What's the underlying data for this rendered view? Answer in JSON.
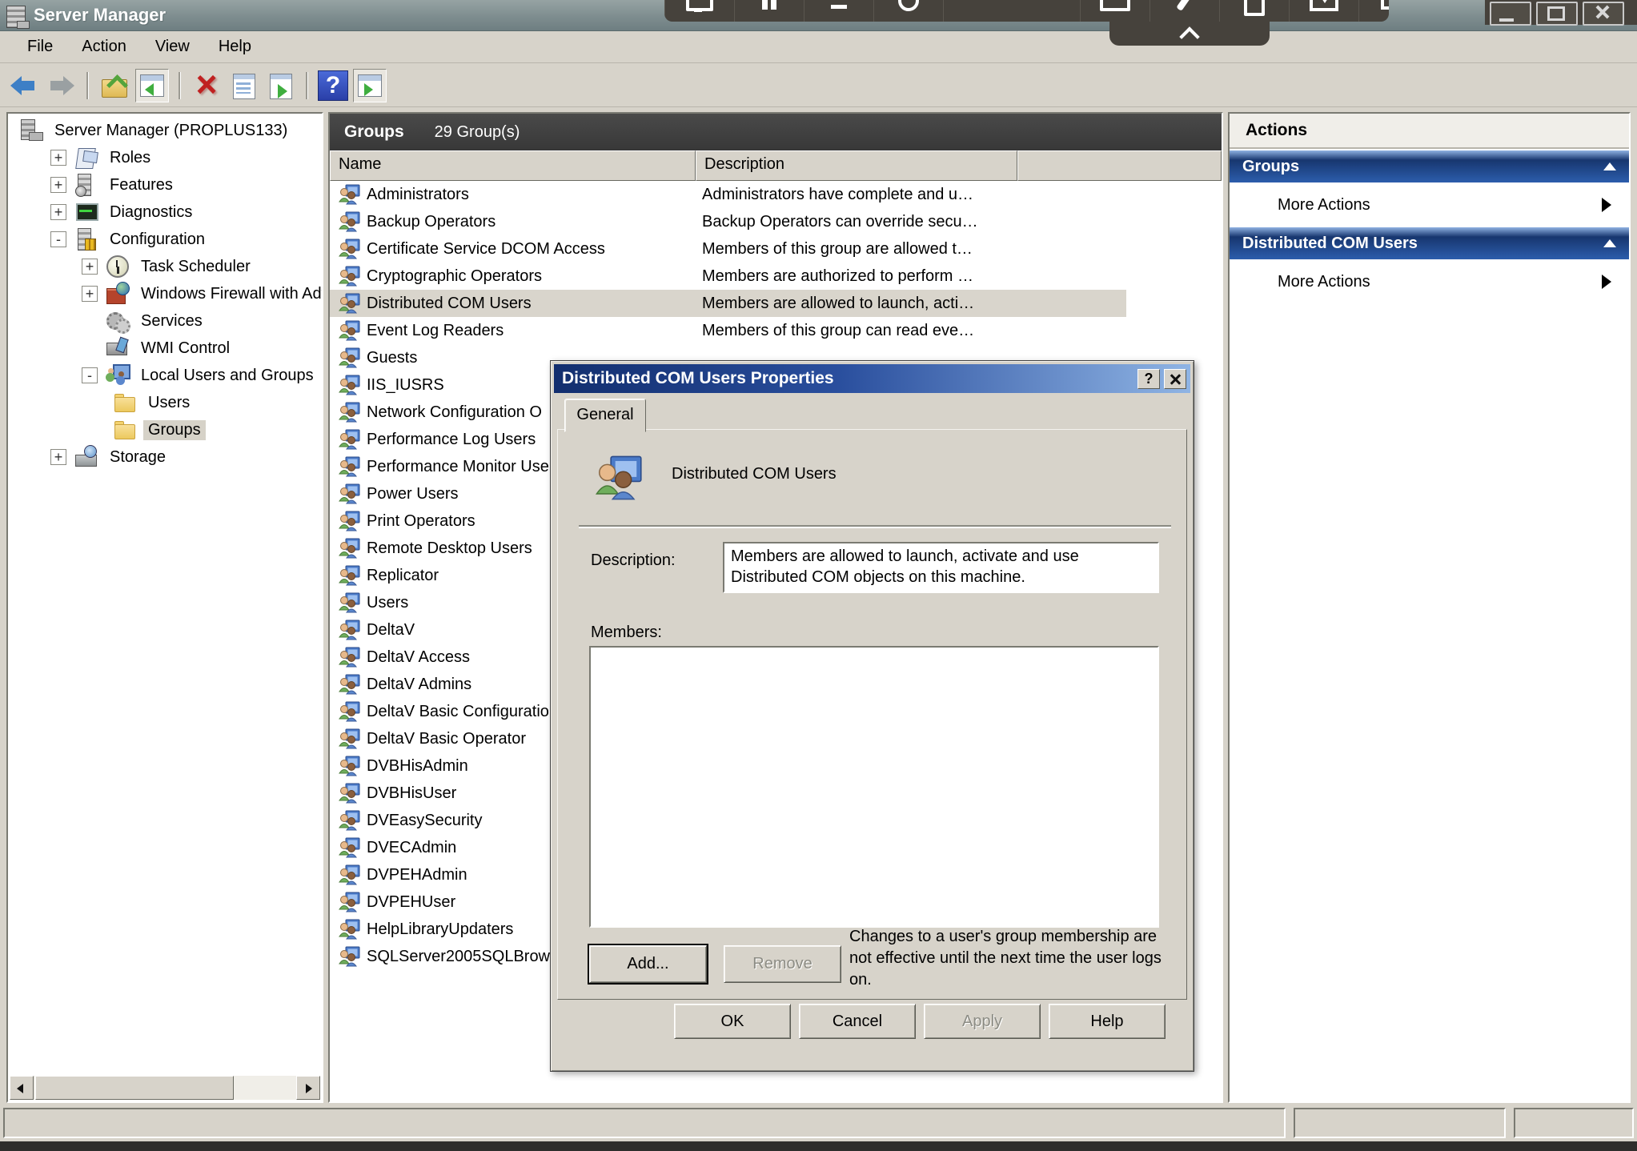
{
  "window": {
    "title": "Server Manager",
    "controls": [
      {
        "name": "minimize-button"
      },
      {
        "name": "maximize-button"
      },
      {
        "name": "close-button"
      }
    ]
  },
  "overlay_toolbar": {
    "icons": [
      {
        "name": "display"
      },
      {
        "name": "pause"
      },
      {
        "name": "minimize"
      },
      {
        "name": "record"
      },
      {
        "name": "spacer"
      },
      {
        "name": "window"
      },
      {
        "name": "tools"
      },
      {
        "name": "clipboard"
      },
      {
        "name": "present"
      },
      {
        "name": "dual-display"
      },
      {
        "name": "grid"
      }
    ]
  },
  "menu": {
    "items": [
      {
        "label": "File"
      },
      {
        "label": "Action"
      },
      {
        "label": "View"
      },
      {
        "label": "Help"
      }
    ]
  },
  "toolbar": {
    "buttons": [
      {
        "name": "back-button"
      },
      {
        "name": "forward-button"
      },
      {
        "name": "toolbar-separator"
      },
      {
        "name": "up-level-button"
      },
      {
        "name": "console-tree-button",
        "active": true
      },
      {
        "name": "toolbar-separator"
      },
      {
        "name": "delete-button",
        "glyph": "×"
      },
      {
        "name": "properties-button"
      },
      {
        "name": "export-list-button"
      },
      {
        "name": "toolbar-separator"
      },
      {
        "name": "help-button",
        "glyph": "?"
      },
      {
        "name": "action-pane-button",
        "active": true
      }
    ]
  },
  "tree": {
    "items": [
      {
        "label": "Server Manager (PROPLUS133)",
        "level": 0,
        "expander": "",
        "noslot": true,
        "icon": "server-manager"
      },
      {
        "label": "Roles",
        "level": 1,
        "expander": "+",
        "icon": "roles"
      },
      {
        "label": "Features",
        "level": 1,
        "expander": "+",
        "icon": "features"
      },
      {
        "label": "Diagnostics",
        "level": 1,
        "expander": "+",
        "icon": "diagnostics"
      },
      {
        "label": "Configuration",
        "level": 1,
        "expander": "-",
        "icon": "configuration"
      },
      {
        "label": "Task Scheduler",
        "level": 2,
        "expander": "+",
        "icon": "task-scheduler"
      },
      {
        "label": "Windows Firewall with Adva",
        "level": 2,
        "expander": "+",
        "icon": "firewall"
      },
      {
        "label": "Services",
        "level": 2,
        "expander": "",
        "icon": "services"
      },
      {
        "label": "WMI Control",
        "level": 2,
        "expander": "",
        "icon": "wmi"
      },
      {
        "label": "Local Users and Groups",
        "level": 2,
        "expander": "-",
        "icon": "local-users"
      },
      {
        "label": "Users",
        "level": 3,
        "expander": "",
        "noslot": true,
        "icon": "folder"
      },
      {
        "label": "Groups",
        "level": 3,
        "expander": "",
        "noslot": true,
        "icon": "folder",
        "selected": true
      },
      {
        "label": "Storage",
        "level": 1,
        "expander": "+",
        "icon": "storage"
      }
    ]
  },
  "groups_pane": {
    "title": "Groups",
    "count_label": "29 Group(s)",
    "columns": {
      "name": "Name",
      "description": "Description"
    },
    "rows": [
      {
        "name": "Administrators",
        "description": "Administrators have complete and u…"
      },
      {
        "name": "Backup Operators",
        "description": "Backup Operators can override secu…"
      },
      {
        "name": "Certificate Service DCOM Access",
        "description": "Members of this group are allowed t…"
      },
      {
        "name": "Cryptographic Operators",
        "description": "Members are authorized to perform …"
      },
      {
        "name": "Distributed COM Users",
        "description": "Members are allowed to launch, acti…",
        "selected": true
      },
      {
        "name": "Event Log Readers",
        "description": "Members of this group can read eve…"
      },
      {
        "name": "Guests",
        "description": ""
      },
      {
        "name": "IIS_IUSRS",
        "description": ""
      },
      {
        "name": "Network Configuration O",
        "description": ""
      },
      {
        "name": "Performance Log Users",
        "description": ""
      },
      {
        "name": "Performance Monitor Use",
        "description": ""
      },
      {
        "name": "Power Users",
        "description": ""
      },
      {
        "name": "Print Operators",
        "description": ""
      },
      {
        "name": "Remote Desktop Users",
        "description": ""
      },
      {
        "name": "Replicator",
        "description": ""
      },
      {
        "name": "Users",
        "description": ""
      },
      {
        "name": "DeltaV",
        "description": ""
      },
      {
        "name": "DeltaV Access",
        "description": ""
      },
      {
        "name": "DeltaV Admins",
        "description": ""
      },
      {
        "name": "DeltaV Basic Configuratio",
        "description": ""
      },
      {
        "name": "DeltaV Basic Operator",
        "description": ""
      },
      {
        "name": "DVBHisAdmin",
        "description": ""
      },
      {
        "name": "DVBHisUser",
        "description": ""
      },
      {
        "name": "DVEasySecurity",
        "description": ""
      },
      {
        "name": "DVECAdmin",
        "description": ""
      },
      {
        "name": "DVPEHAdmin",
        "description": ""
      },
      {
        "name": "DVPEHUser",
        "description": ""
      },
      {
        "name": "HelpLibraryUpdaters",
        "description": ""
      },
      {
        "name": "SQLServer2005SQLBrow",
        "description": ""
      }
    ]
  },
  "actions_pane": {
    "title": "Actions",
    "sections": [
      {
        "title": "Groups",
        "item": "More Actions"
      },
      {
        "title": "Distributed COM Users",
        "item": "More Actions"
      }
    ]
  },
  "dialog": {
    "title": "Distributed COM Users Properties",
    "help_glyph": "?",
    "tab": "General",
    "group_name": "Distributed COM Users",
    "description_label": "Description:",
    "description_value": "Members are allowed to launch, activate and use Distributed COM objects on this machine.",
    "members_label": "Members:",
    "add_button": "Add...",
    "remove_button": "Remove",
    "note": "Changes to a user's group membership are not effective until the next time the user logs on.",
    "action_buttons": [
      {
        "label": "OK",
        "name": "ok-button"
      },
      {
        "label": "Cancel",
        "name": "cancel-button"
      },
      {
        "label": "Apply",
        "name": "apply-button",
        "disabled": true
      },
      {
        "label": "Help",
        "name": "help-button"
      }
    ]
  },
  "colors": {
    "titlebar": "#7e8d8f",
    "dark_header": "#3d3d3d",
    "action_bar_blue": "#17366f",
    "dialog_title_blue": "#122e6e",
    "selection_gray": "#d9d5cc",
    "face": "#d7d3ca"
  }
}
